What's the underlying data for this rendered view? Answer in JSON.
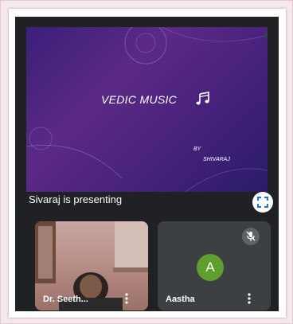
{
  "slide": {
    "title": "VEDIC MUSIC",
    "by": "BY",
    "author": "SHIVARAJ"
  },
  "status": {
    "presenting_text": "Sivaraj is presenting"
  },
  "participants": [
    {
      "name": "Dr. Seeth...",
      "video": "camera-on"
    },
    {
      "name": "Aastha",
      "avatar_letter": "A",
      "avatar_color": "#5e9e2c",
      "mic": "muted"
    }
  ],
  "icons": {
    "fullscreen": "expand-icon",
    "music": "music-note-icon",
    "more": "more-vert-icon",
    "mute": "mic-off-icon"
  },
  "colors": {
    "meet_background": "#202124",
    "tile_background": "#3c4043",
    "slide_background": "#4a237e"
  }
}
